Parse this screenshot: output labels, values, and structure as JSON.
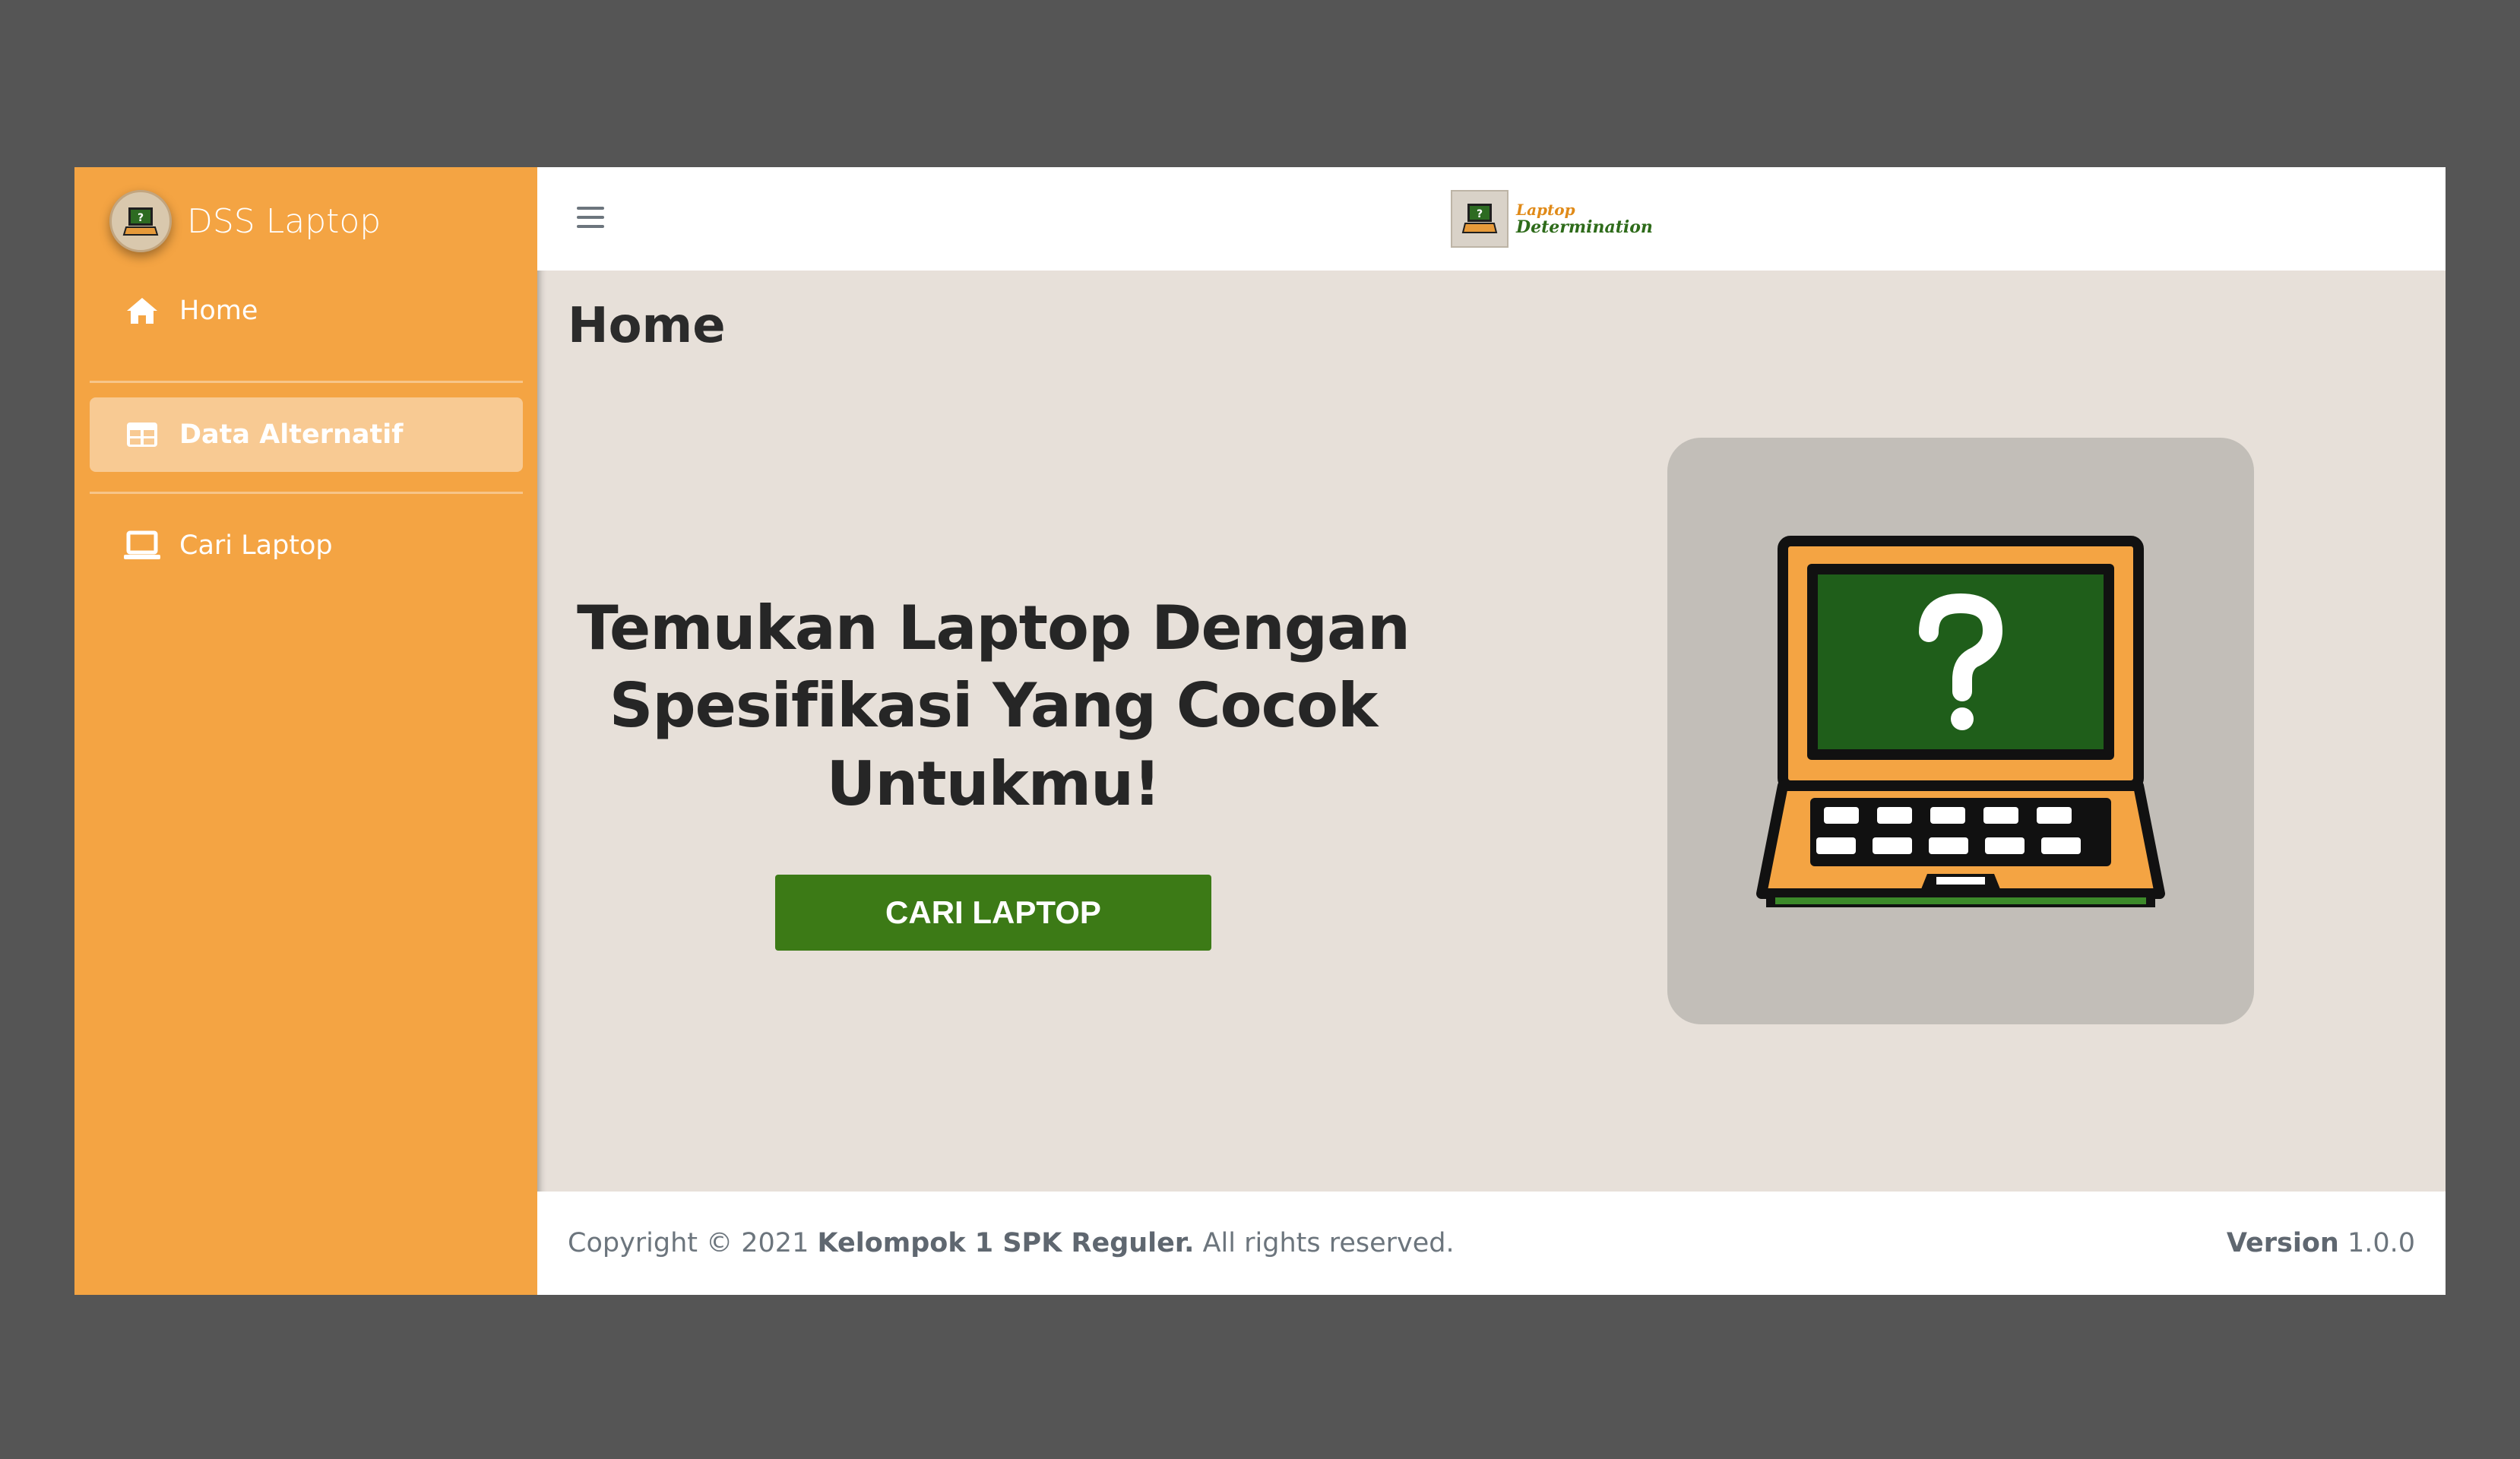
{
  "sidebar": {
    "brand": "DSS Laptop",
    "items": [
      {
        "label": "Home",
        "icon": "home-icon"
      },
      {
        "label": "Data Alternatif",
        "icon": "table-icon",
        "active": true
      },
      {
        "label": "Cari Laptop",
        "icon": "laptop-icon"
      }
    ]
  },
  "topbar": {
    "logo_line1": "Laptop",
    "logo_line2": "Determination"
  },
  "main": {
    "page_title": "Home",
    "hero_text": "Temukan Laptop Dengan Spesifikasi Yang Cocok Untukmu!",
    "cta_label": "CARI LAPTOP"
  },
  "footer": {
    "copyright_prefix": "Copyright © 2021",
    "copyright_owner": "Kelompok 1 SPK Reguler.",
    "copyright_suffix": "All rights reserved.",
    "version_label": "Version",
    "version_number": "1.0.0"
  },
  "colors": {
    "sidebar_bg": "#F4A443",
    "active_item_bg": "#F8CA93",
    "cta_bg": "#3C7A16",
    "content_bg": "#E7E0D9",
    "screen_green": "#1F5E1A"
  }
}
